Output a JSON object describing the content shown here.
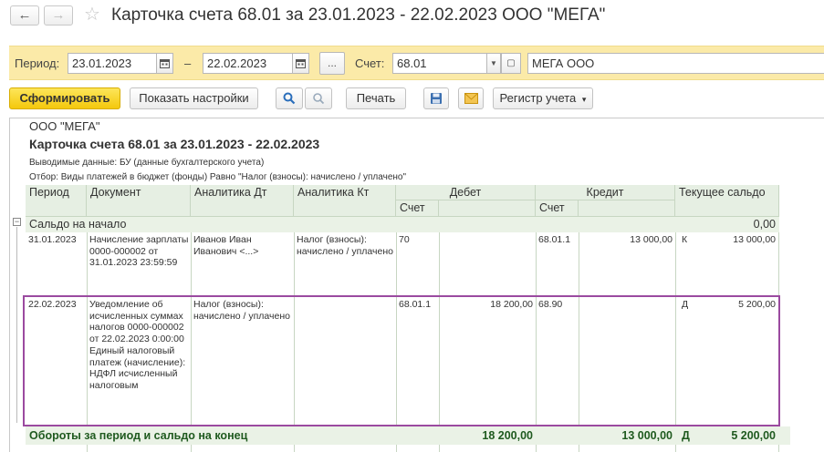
{
  "window": {
    "title": "Карточка счета 68.01 за 23.01.2023 - 22.02.2023 ООО \"МЕГА\"",
    "back_icon": "←",
    "forward_icon": "→",
    "star_icon": "☆"
  },
  "params": {
    "period_label": "Период:",
    "date_from": "23.01.2023",
    "dash": "–",
    "date_to": "22.02.2023",
    "dots_label": "...",
    "account_label": "Счет:",
    "account_value": "68.01",
    "organization_value": "МЕГА ООО"
  },
  "toolbar": {
    "generate_label": "Сформировать",
    "settings_label": "Показать настройки",
    "print_label": "Печать",
    "register_label": "Регистр учета"
  },
  "report": {
    "org": "ООО \"МЕГА\"",
    "title": "Карточка счета 68.01 за 23.01.2023 - 22.02.2023",
    "output_data": "Выводимые данные: БУ (данные бухгалтерского учета)",
    "filter": "Отбор: Виды платежей в бюджет (фонды) Равно \"Налог (взносы): начислено / уплачено\"",
    "columns": {
      "period": "Период",
      "document": "Документ",
      "analytics_dt": "Аналитика Дт",
      "analytics_kt": "Аналитика Кт",
      "debit": "Дебет",
      "credit": "Кредит",
      "balance": "Текущее сальдо",
      "debit_account": "Счет",
      "credit_account": "Счет"
    },
    "opening": {
      "label": "Сальдо на начало",
      "value": "0,00",
      "toggle": "−"
    },
    "rows": [
      {
        "period": "31.01.2023",
        "document": "Начисление зарплаты 0000-000002 от 31.01.2023 23:59:59",
        "analytics_dt": "Иванов Иван Иванович <...>",
        "analytics_kt": "Налог (взносы): начислено / уплачено",
        "debit_account": "70",
        "debit_sum": "",
        "credit_account": "68.01.1",
        "credit_sum": "13 000,00",
        "balance_side": "К",
        "balance": "13 000,00"
      },
      {
        "period": "22.02.2023",
        "document": "Уведомление об исчисленных суммах налогов 0000-000002 от 22.02.2023 0:00:00 Единый налоговый платеж (начисление): НДФЛ исчисленный налоговым",
        "analytics_dt": "Налог (взносы): начислено / уплачено",
        "analytics_kt": "",
        "debit_account": "68.01.1",
        "debit_sum": "18 200,00",
        "credit_account": "68.90",
        "credit_sum": "",
        "balance_side": "Д",
        "balance": "5 200,00"
      }
    ],
    "totals": {
      "label": "Обороты за период и сальдо на конец",
      "debit": "18 200,00",
      "credit": "13 000,00",
      "side": "Д",
      "balance": "5 200,00"
    }
  },
  "colors": {
    "panel": "#fbeaa8",
    "primary_button": "#f4c80c",
    "header": "#e6efe3",
    "highlight": "#9b4aa0"
  }
}
